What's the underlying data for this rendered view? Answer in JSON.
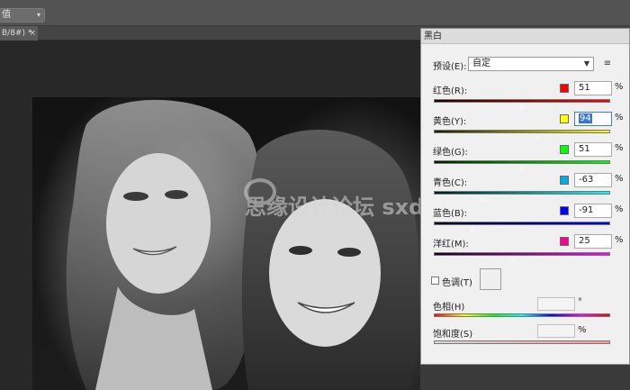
{
  "options_bar": {
    "dropdown_value": "值"
  },
  "document_tab": {
    "label": "B/8#) *",
    "close": "×"
  },
  "watermark": {
    "text": "思缘设计论坛 sxd.cn"
  },
  "bw_panel": {
    "title": "黑白",
    "preset": {
      "label": "预设(E):",
      "value": "自定",
      "menu_icon": "≡"
    },
    "sliders": [
      {
        "label": "红色(R):",
        "value": "51",
        "swatch": "#ff0000",
        "gradient": [
          "#1a0000",
          "#ff0000"
        ],
        "min": -200,
        "max": 300,
        "position": 51
      },
      {
        "label": "黄色(Y):",
        "value": "94",
        "swatch": "#ffff00",
        "gradient": [
          "#1a1a00",
          "#ffff00"
        ],
        "min": -200,
        "max": 300,
        "position": 94,
        "focused": true
      },
      {
        "label": "绿色(G):",
        "value": "51",
        "swatch": "#00ff00",
        "gradient": [
          "#001a00",
          "#00ff00"
        ],
        "min": -200,
        "max": 300,
        "position": 51
      },
      {
        "label": "青色(C):",
        "value": "-63",
        "swatch": "#00a8e8",
        "gradient": [
          "#001a1a",
          "#00ffff"
        ],
        "min": -200,
        "max": 300,
        "position": -63
      },
      {
        "label": "蓝色(B):",
        "value": "-91",
        "swatch": "#0000ff",
        "gradient": [
          "#00001a",
          "#0000ff"
        ],
        "min": -200,
        "max": 300,
        "position": -91
      },
      {
        "label": "洋红(M):",
        "value": "25",
        "swatch": "#ff0090",
        "gradient": [
          "#1a001a",
          "#ff00ff"
        ],
        "min": -200,
        "max": 300,
        "position": 25
      }
    ],
    "percent": "%",
    "tint": {
      "label": "色调(T)",
      "checked": false
    },
    "hue": {
      "label": "色相(H)",
      "unit": "°"
    },
    "saturation": {
      "label": "饱和度(S)",
      "unit": "%"
    }
  }
}
